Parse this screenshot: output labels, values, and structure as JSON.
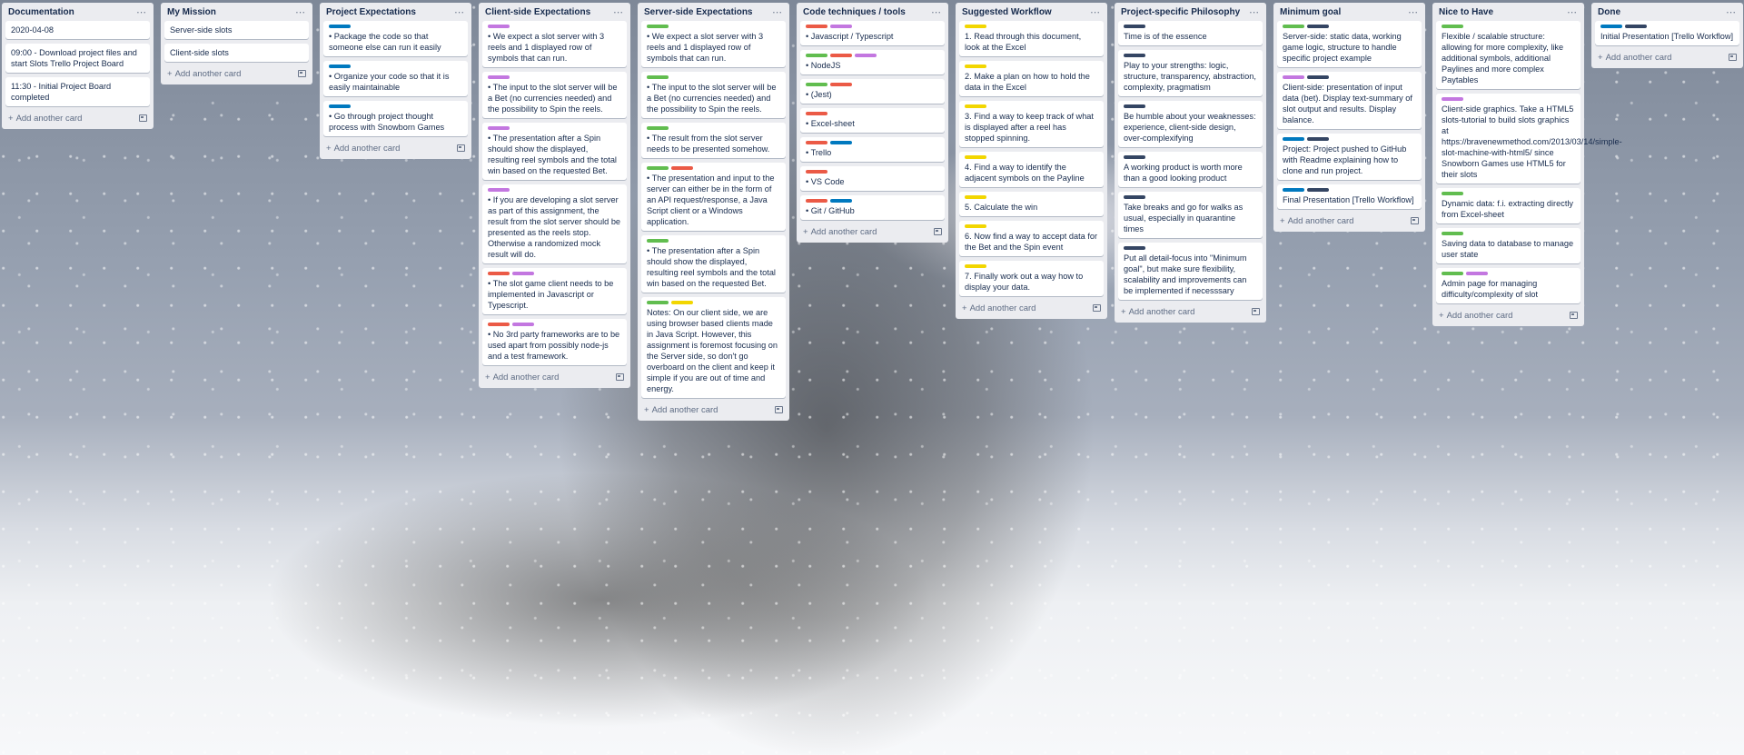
{
  "colors": {
    "blue": "#0079bf",
    "purple": "#c377e0",
    "green": "#61bd4f",
    "red": "#eb5a46",
    "yellow": "#f2d600",
    "navy": "#344563"
  },
  "board": {
    "add_card_label": "Add another card",
    "lists": [
      {
        "title": "Documentation",
        "cards": [
          {
            "labels": [],
            "text": "2020-04-08"
          },
          {
            "labels": [],
            "text": "09:00 - Download project files and start                   Slots Trello Project Board"
          },
          {
            "labels": [],
            "text": "11:30 - Initial Project Board completed"
          }
        ]
      },
      {
        "title": "My Mission",
        "cards": [
          {
            "labels": [],
            "text": "Server-side slots"
          },
          {
            "labels": [],
            "text": "Client-side slots"
          }
        ]
      },
      {
        "title": "Project Expectations",
        "cards": [
          {
            "labels": [
              "blue"
            ],
            "text": "• Package the code so that someone else can run it easily"
          },
          {
            "labels": [
              "blue"
            ],
            "text": "• Organize your code so that it is easily maintainable"
          },
          {
            "labels": [
              "blue"
            ],
            "text": "• Go through project thought process with Snowborn Games"
          }
        ]
      },
      {
        "title": "Client-side Expectations",
        "cards": [
          {
            "labels": [
              "purple"
            ],
            "text": "• We expect a slot server with 3 reels and 1 displayed row of symbols that can run."
          },
          {
            "labels": [
              "purple"
            ],
            "text": "• The input to the slot server will be a Bet (no currencies needed) and the possibility to Spin the reels."
          },
          {
            "labels": [
              "purple"
            ],
            "text": "• The presentation after a Spin should show the displayed, resulting reel symbols and the total win based on the requested Bet."
          },
          {
            "labels": [
              "purple"
            ],
            "text": "• If you are developing a slot server as part of this assignment, the result from the slot server should be presented as the reels stop. Otherwise a randomized mock result will do."
          },
          {
            "labels": [
              "red",
              "purple"
            ],
            "text": "• The slot game client needs to be implemented in Javascript or Typescript."
          },
          {
            "labels": [
              "red",
              "purple"
            ],
            "text": "• No 3rd party frameworks are to be used apart from possibly node-js and a test framework."
          }
        ]
      },
      {
        "title": "Server-side Expectations",
        "cards": [
          {
            "labels": [
              "green"
            ],
            "text": "• We expect a slot server with 3 reels and 1 displayed row of symbols that can run."
          },
          {
            "labels": [
              "green"
            ],
            "text": "• The input to the slot server will be a Bet (no currencies needed) and the possibility to Spin the reels."
          },
          {
            "labels": [
              "green"
            ],
            "text": "• The result from the slot server needs to be presented somehow."
          },
          {
            "labels": [
              "green",
              "red"
            ],
            "text": "• The presentation and input to the server can either be in the form of an API request/response, a Java Script client or a Windows application."
          },
          {
            "labels": [
              "green"
            ],
            "text": "• The presentation after a Spin should show the displayed, resulting reel symbols and the total win based on the requested Bet."
          },
          {
            "labels": [
              "green",
              "yellow"
            ],
            "text": "Notes: On our client side, we are using browser based clients made in Java Script. However, this assignment is foremost focusing on the Server side, so don't go overboard on the client and keep it simple if you are out of time and energy."
          }
        ]
      },
      {
        "title": "Code techniques / tools",
        "cards": [
          {
            "labels": [
              "red",
              "purple"
            ],
            "text": "• Javascript / Typescript"
          },
          {
            "labels": [
              "green",
              "red",
              "purple"
            ],
            "text": "• NodeJS"
          },
          {
            "labels": [
              "green",
              "red"
            ],
            "text": "• (Jest)"
          },
          {
            "labels": [
              "red"
            ],
            "text": "• Excel-sheet"
          },
          {
            "labels": [
              "red",
              "blue"
            ],
            "text": "• Trello"
          },
          {
            "labels": [
              "red"
            ],
            "text": "• VS Code"
          },
          {
            "labels": [
              "red",
              "blue"
            ],
            "text": "• Git / GitHub"
          }
        ]
      },
      {
        "title": "Suggested Workflow",
        "cards": [
          {
            "labels": [
              "yellow"
            ],
            "text": "1. Read through this document, look at the Excel"
          },
          {
            "labels": [
              "yellow"
            ],
            "text": "2. Make a plan on how to hold the data in the Excel"
          },
          {
            "labels": [
              "yellow"
            ],
            "text": "3. Find a way to keep track of what is displayed after a reel has stopped spinning."
          },
          {
            "labels": [
              "yellow"
            ],
            "text": "4. Find a way to identify the adjacent symbols on the Payline"
          },
          {
            "labels": [
              "yellow"
            ],
            "text": "5. Calculate the win"
          },
          {
            "labels": [
              "yellow"
            ],
            "text": "6. Now find a way to accept data for the Bet and the Spin event"
          },
          {
            "labels": [
              "yellow"
            ],
            "text": "7. Finally work out a way how to display your data."
          }
        ]
      },
      {
        "title": "Project-specific Philosophy",
        "cards": [
          {
            "labels": [
              "navy"
            ],
            "text": "Time is of the essence"
          },
          {
            "labels": [
              "navy"
            ],
            "text": "Play to your strengths: logic, structure, transparency, abstraction, complexity, pragmatism"
          },
          {
            "labels": [
              "navy"
            ],
            "text": "Be humble about your weaknesses: experience, client-side design, over-complexifying"
          },
          {
            "labels": [
              "navy"
            ],
            "text": "A working product is worth more than a good looking product"
          },
          {
            "labels": [
              "navy"
            ],
            "text": "Take breaks and go for walks as usual, especially in quarantine times"
          },
          {
            "labels": [
              "navy"
            ],
            "text": "Put all detail-focus into \"Minimum goal\", but make sure flexibility, scalability and improvements can be implemented if necesssary"
          }
        ]
      },
      {
        "title": "Minimum goal",
        "cards": [
          {
            "labels": [
              "green",
              "navy"
            ],
            "text": "Server-side: static data, working game logic, structure to handle specific project example"
          },
          {
            "labels": [
              "purple",
              "navy"
            ],
            "text": "Client-side: presentation of input data (bet). Display text-summary of slot output and results. Display balance."
          },
          {
            "labels": [
              "blue",
              "navy"
            ],
            "text": "Project: Project pushed to GitHub with Readme explaining how to clone and run project."
          },
          {
            "labels": [
              "blue",
              "navy"
            ],
            "text": "Final Presentation [Trello Workflow]"
          }
        ]
      },
      {
        "title": "Nice to Have",
        "cards": [
          {
            "labels": [
              "green"
            ],
            "text": "Flexible / scalable structure: allowing for more complexity, like additional symbols, additional Paylines and more complex Paytables"
          },
          {
            "labels": [
              "purple"
            ],
            "text": "Client-side graphics. Take a HTML5 slots-tutorial to build slots graphics at https://bravenewmethod.com/2013/03/14/simple-slot-machine-with-html5/ since Snowborn Games use HTML5 for their slots"
          },
          {
            "labels": [
              "green"
            ],
            "text": "Dynamic data: f.i. extracting directly from Excel-sheet"
          },
          {
            "labels": [
              "green"
            ],
            "text": "Saving data to database to manage user state"
          },
          {
            "labels": [
              "green",
              "purple"
            ],
            "text": "Admin page for managing difficulty/complexity of slot"
          }
        ]
      },
      {
        "title": "Done",
        "cards": [
          {
            "labels": [
              "blue",
              "navy"
            ],
            "text": "Initial Presentation [Trello Workflow]"
          }
        ]
      }
    ]
  }
}
